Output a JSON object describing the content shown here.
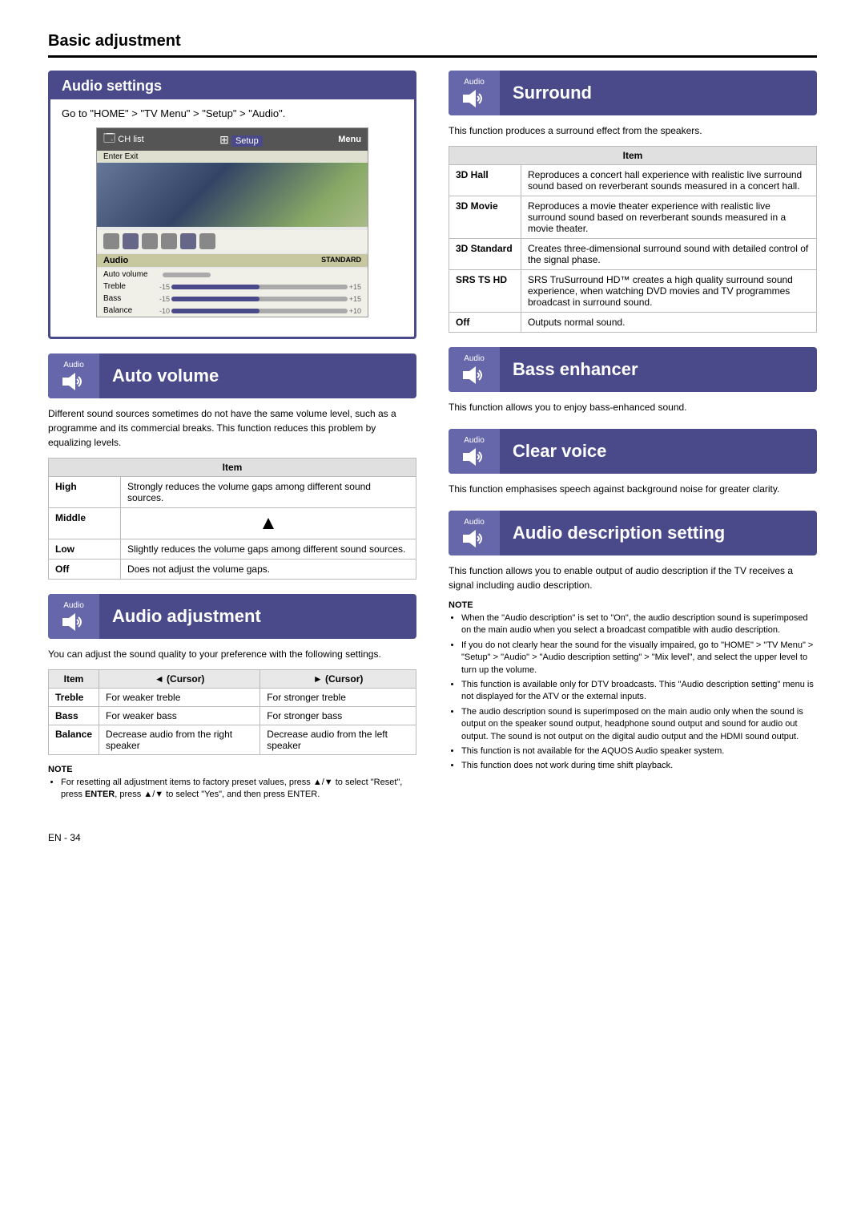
{
  "page": {
    "title": "Basic adjustment",
    "footer": "EN - 34"
  },
  "audio_settings": {
    "box_title": "Audio settings",
    "go_to": "Go to \"HOME\" > \"TV Menu\" > \"Setup\" > \"Audio\".",
    "menu": {
      "top_bar_label": "Menu",
      "ch_list": "CH list",
      "setup": "Setup",
      "enter_exit": "Enter  Exit",
      "audio_label": "Audio",
      "standard_label": "STANDARD",
      "auto_volume": "Auto volume",
      "sliders": [
        {
          "label": "Treble",
          "value": "[0]",
          "min": "-15",
          "max": "+15"
        },
        {
          "label": "Bass",
          "value": "[0]",
          "min": "-15",
          "max": "+15"
        },
        {
          "label": "Balance",
          "value": "[0]",
          "min": "-10",
          "max": "+10"
        }
      ]
    }
  },
  "auto_volume": {
    "audio_label": "Audio",
    "title": "Auto volume",
    "description": "Different sound sources sometimes do not have the same volume level, such as a programme and its commercial breaks. This function reduces this problem by equalizing levels.",
    "table_header": "Item",
    "items": [
      {
        "name": "High",
        "description": "Strongly reduces the volume gaps among different sound sources."
      },
      {
        "name": "Middle",
        "description": ""
      },
      {
        "name": "Low",
        "description": "Slightly reduces the volume gaps among different sound sources."
      },
      {
        "name": "Off",
        "description": "Does not adjust the volume gaps."
      }
    ]
  },
  "audio_adjustment": {
    "audio_label": "Audio",
    "title": "Audio adjustment",
    "description": "You can adjust the sound quality to your preference with the following settings.",
    "table_headers": [
      "Item",
      "◄ (Cursor)",
      "► (Cursor)"
    ],
    "items": [
      {
        "name": "Treble",
        "left": "For weaker treble",
        "right": "For stronger treble"
      },
      {
        "name": "Bass",
        "left": "For weaker bass",
        "right": "For stronger bass"
      },
      {
        "name": "Balance",
        "left": "Decrease audio from the right speaker",
        "right": "Decrease audio from the left speaker"
      }
    ],
    "note_title": "NOTE",
    "notes": [
      "For resetting all adjustment items to factory preset values, press ▲/▼ to select \"Reset\", press ENTER, press ▲/▼ to select \"Yes\", and then press ENTER."
    ]
  },
  "surround": {
    "audio_label": "Audio",
    "title": "Surround",
    "description": "This function produces a surround effect from the speakers.",
    "table_header": "Item",
    "items": [
      {
        "name": "3D Hall",
        "description": "Reproduces a concert hall experience with realistic live surround sound based on reverberant sounds measured in a concert hall."
      },
      {
        "name": "3D Movie",
        "description": "Reproduces a movie theater experience with realistic live surround sound based on reverberant sounds measured in a movie theater."
      },
      {
        "name": "3D Standard",
        "description": "Creates three-dimensional surround sound with detailed control of the signal phase."
      },
      {
        "name": "SRS TS HD",
        "description": "SRS TruSurround HD™ creates a high quality surround sound experience, when watching DVD movies and TV programmes broadcast in surround sound."
      },
      {
        "name": "Off",
        "description": "Outputs normal sound."
      }
    ]
  },
  "bass_enhancer": {
    "audio_label": "Audio",
    "title": "Bass enhancer",
    "description": "This function allows you to enjoy bass-enhanced sound."
  },
  "clear_voice": {
    "audio_label": "Audio",
    "title": "Clear voice",
    "description": "This function emphasises speech against background noise for greater clarity."
  },
  "audio_description": {
    "audio_label": "Audio",
    "title": "Audio description setting",
    "description": "This function allows you to enable output of audio description if the TV receives a signal including audio description.",
    "note_title": "NOTE",
    "notes": [
      "When the \"Audio description\" is set to \"On\", the audio description sound is superimposed on the main audio when you select a broadcast compatible with audio description.",
      "If you do not clearly hear the sound for the visually impaired, go to \"HOME\" > \"TV Menu\" > \"Setup\" > \"Audio\" > \"Audio description setting\" > \"Mix level\", and select the upper level to turn up the volume.",
      "This function is available only for DTV broadcasts. This \"Audio description setting\" menu is not displayed for the ATV or the external inputs.",
      "The audio description sound is superimposed on the main audio only when the sound is output on the speaker sound output, headphone sound output and sound for audio out output. The sound is not output on the digital audio output and the HDMI sound output.",
      "This function is not available for the AQUOS Audio speaker system.",
      "This function does not work during time shift playback."
    ]
  }
}
